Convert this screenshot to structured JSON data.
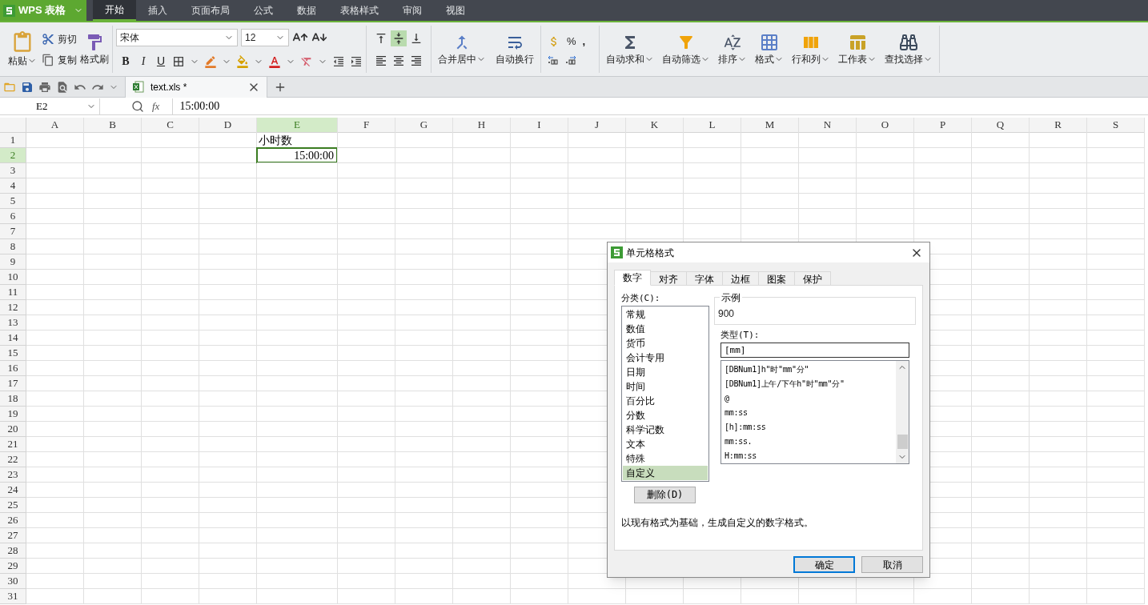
{
  "app_button": {
    "label": "WPS 表格"
  },
  "menu_tabs": [
    {
      "label": "开始",
      "selected": true
    },
    {
      "label": "插入",
      "selected": false
    },
    {
      "label": "页面布局",
      "selected": false
    },
    {
      "label": "公式",
      "selected": false
    },
    {
      "label": "数据",
      "selected": false
    },
    {
      "label": "表格样式",
      "selected": false
    },
    {
      "label": "审阅",
      "selected": false
    },
    {
      "label": "视图",
      "selected": false
    }
  ],
  "ribbon": {
    "paste": "粘贴",
    "cut": "剪切",
    "copy": "复制",
    "format_painter": "格式刷",
    "font_name": "宋体",
    "font_size": "12",
    "bold": "B",
    "italic": "I",
    "underline": "U",
    "vertical_align": [
      {
        "selected": false
      },
      {
        "selected": true
      },
      {
        "selected": false
      }
    ],
    "merge_center": "合并居中",
    "wrap_text": "自动换行",
    "percent": "%",
    "comma": ",",
    "large_buttons": [
      "自动求和",
      "自动筛选",
      "排序",
      "格式",
      "行和列",
      "工作表",
      "查找选择"
    ]
  },
  "document_tab": {
    "title": "text.xls *"
  },
  "formula_bar": {
    "name_box": "E2",
    "fx": "fx",
    "value": "15:00:00"
  },
  "sheet": {
    "columns": [
      {
        "label": "A",
        "selected": false
      },
      {
        "label": "B",
        "selected": false
      },
      {
        "label": "C",
        "selected": false
      },
      {
        "label": "D",
        "selected": false
      },
      {
        "label": "E",
        "selected": true,
        "cells": [
          {
            "text": "小时数",
            "kind": "text",
            "selected": false
          },
          {
            "text": "15:00:00",
            "kind": "number",
            "selected": true
          }
        ]
      },
      {
        "label": "F",
        "selected": false
      },
      {
        "label": "G",
        "selected": false
      },
      {
        "label": "H",
        "selected": false
      },
      {
        "label": "I",
        "selected": false
      },
      {
        "label": "J",
        "selected": false
      },
      {
        "label": "K",
        "selected": false
      },
      {
        "label": "L",
        "selected": false
      },
      {
        "label": "M",
        "selected": false
      },
      {
        "label": "N",
        "selected": false
      },
      {
        "label": "O",
        "selected": false
      },
      {
        "label": "P",
        "selected": false
      },
      {
        "label": "Q",
        "selected": false
      },
      {
        "label": "R",
        "selected": false
      },
      {
        "label": "S",
        "selected": false
      }
    ],
    "rows": [
      {
        "label": "1",
        "selected": false
      },
      {
        "label": "2",
        "selected": true
      },
      {
        "label": "3",
        "selected": false
      },
      {
        "label": "4",
        "selected": false
      },
      {
        "label": "5",
        "selected": false
      },
      {
        "label": "6",
        "selected": false
      },
      {
        "label": "7",
        "selected": false
      },
      {
        "label": "8",
        "selected": false
      },
      {
        "label": "9",
        "selected": false
      },
      {
        "label": "10",
        "selected": false
      },
      {
        "label": "11",
        "selected": false
      },
      {
        "label": "12",
        "selected": false
      },
      {
        "label": "13",
        "selected": false
      },
      {
        "label": "14",
        "selected": false
      },
      {
        "label": "15",
        "selected": false
      },
      {
        "label": "16",
        "selected": false
      },
      {
        "label": "17",
        "selected": false
      },
      {
        "label": "18",
        "selected": false
      },
      {
        "label": "19",
        "selected": false
      },
      {
        "label": "20",
        "selected": false
      },
      {
        "label": "21",
        "selected": false
      },
      {
        "label": "22",
        "selected": false
      },
      {
        "label": "23",
        "selected": false
      },
      {
        "label": "24",
        "selected": false
      },
      {
        "label": "25",
        "selected": false
      },
      {
        "label": "26",
        "selected": false
      },
      {
        "label": "27",
        "selected": false
      },
      {
        "label": "28",
        "selected": false
      },
      {
        "label": "29",
        "selected": false
      },
      {
        "label": "30",
        "selected": false
      },
      {
        "label": "31",
        "selected": false
      }
    ]
  },
  "dialog": {
    "title": "单元格格式",
    "tabs": [
      {
        "label": "数字",
        "selected": true
      },
      {
        "label": "对齐",
        "selected": false
      },
      {
        "label": "字体",
        "selected": false
      },
      {
        "label": "边框",
        "selected": false
      },
      {
        "label": "图案",
        "selected": false
      },
      {
        "label": "保护",
        "selected": false
      }
    ],
    "category_label": "分类(C):",
    "categories": [
      {
        "label": "常规",
        "selected": false
      },
      {
        "label": "数值",
        "selected": false
      },
      {
        "label": "货币",
        "selected": false
      },
      {
        "label": "会计专用",
        "selected": false
      },
      {
        "label": "日期",
        "selected": false
      },
      {
        "label": "时间",
        "selected": false
      },
      {
        "label": "百分比",
        "selected": false
      },
      {
        "label": "分数",
        "selected": false
      },
      {
        "label": "科学记数",
        "selected": false
      },
      {
        "label": "文本",
        "selected": false
      },
      {
        "label": "特殊",
        "selected": false
      },
      {
        "label": "自定义",
        "selected": true
      }
    ],
    "sample_label": "示例",
    "sample_value": "900",
    "type_label": "类型(T):",
    "type_value": "[mm]",
    "formats": [
      "[DBNum1]h\"时\"mm\"分\"",
      "[DBNum1]上午/下午h\"时\"mm\"分\"",
      "@",
      "mm:ss",
      "[h]:mm:ss",
      "mm:ss.",
      "H:mm:ss"
    ],
    "delete_button": "删除(D)",
    "description": "以现有格式为基础，生成自定义的数字格式。",
    "buttons": [
      {
        "label": "确定",
        "default": true
      },
      {
        "label": "取消",
        "default": false
      }
    ]
  }
}
